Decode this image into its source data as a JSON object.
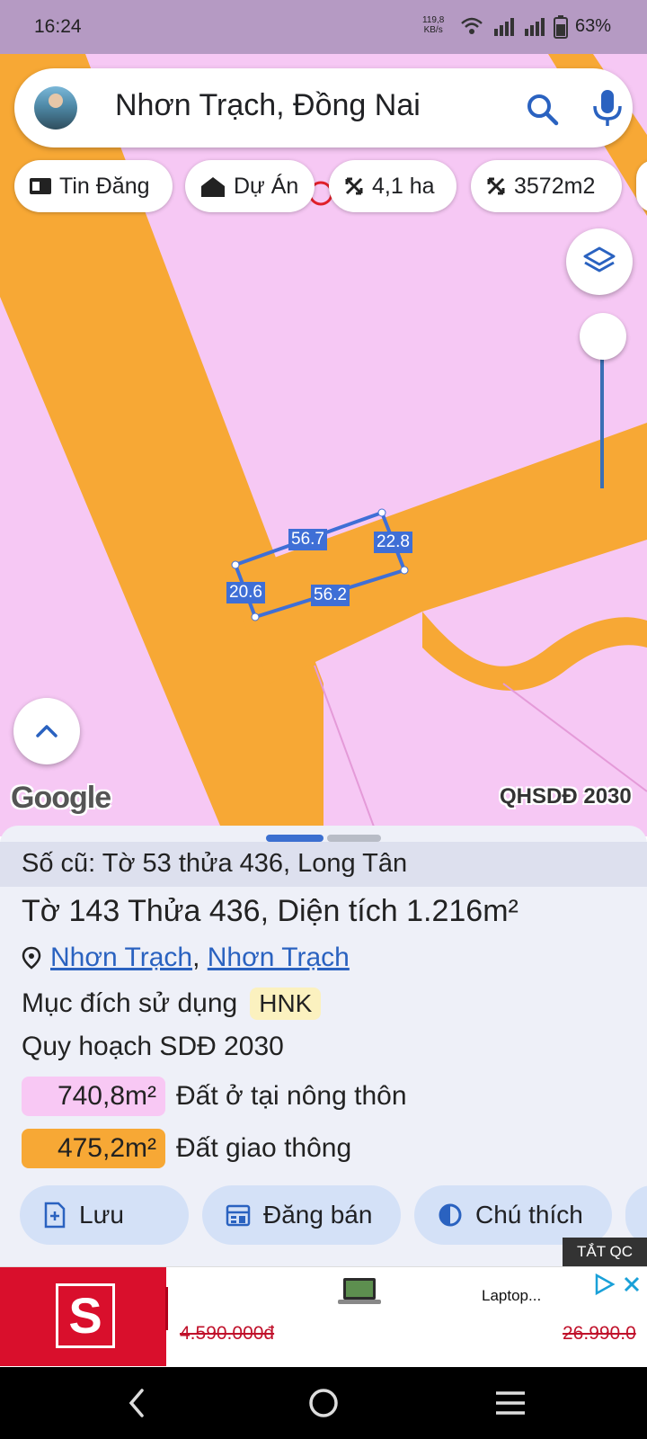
{
  "status_bar": {
    "time": "16:24",
    "net_speed": "119,8",
    "net_unit": "KB/s",
    "battery": "63%"
  },
  "search": {
    "query": "Nhơn Trạch, Đồng Nai"
  },
  "chips": [
    {
      "label": "Tin Đăng",
      "icon": "listing-icon"
    },
    {
      "label": "Dự Án",
      "icon": "building-icon"
    },
    {
      "label": "4,1 ha",
      "icon": "area-icon"
    },
    {
      "label": "3572m2",
      "icon": "area-icon"
    }
  ],
  "map": {
    "measurements": {
      "top": "56.7",
      "right": "22.8",
      "left": "20.6",
      "bottom": "56.2"
    },
    "provider": "Google",
    "layer_label": "QHSDĐ 2030"
  },
  "sheet": {
    "old_info": "Số cũ: Tờ 53 thửa 436, Long Tân",
    "title": "Tờ 143 Thửa 436, Diện tích 1.216m²",
    "address_1": "Nhơn Trạch",
    "address_sep": ",",
    "address_2": "Nhơn Trạch",
    "purpose_label": "Mục đích sử dụng",
    "purpose_code": "HNK",
    "plan_label": "Quy hoạch SDĐ 2030",
    "zones": [
      {
        "area": "740,8m²",
        "name": "Đất ở tại nông thôn",
        "color": "#f8c8f4"
      },
      {
        "area": "475,2m²",
        "name": "Đất giao thông",
        "color": "#f7a835"
      }
    ],
    "actions": {
      "save": "Lưu",
      "post": "Đăng bán",
      "legend": "Chú thích"
    }
  },
  "ad": {
    "close_label": "TẮT QC",
    "product_title": "Laptop...",
    "price_left": "4.590.000đ",
    "price_right": "26.990.0"
  },
  "colors": {
    "land_pink": "#f6c8f4",
    "road_orange": "#f7a835",
    "accent_blue": "#3f6fd6"
  }
}
